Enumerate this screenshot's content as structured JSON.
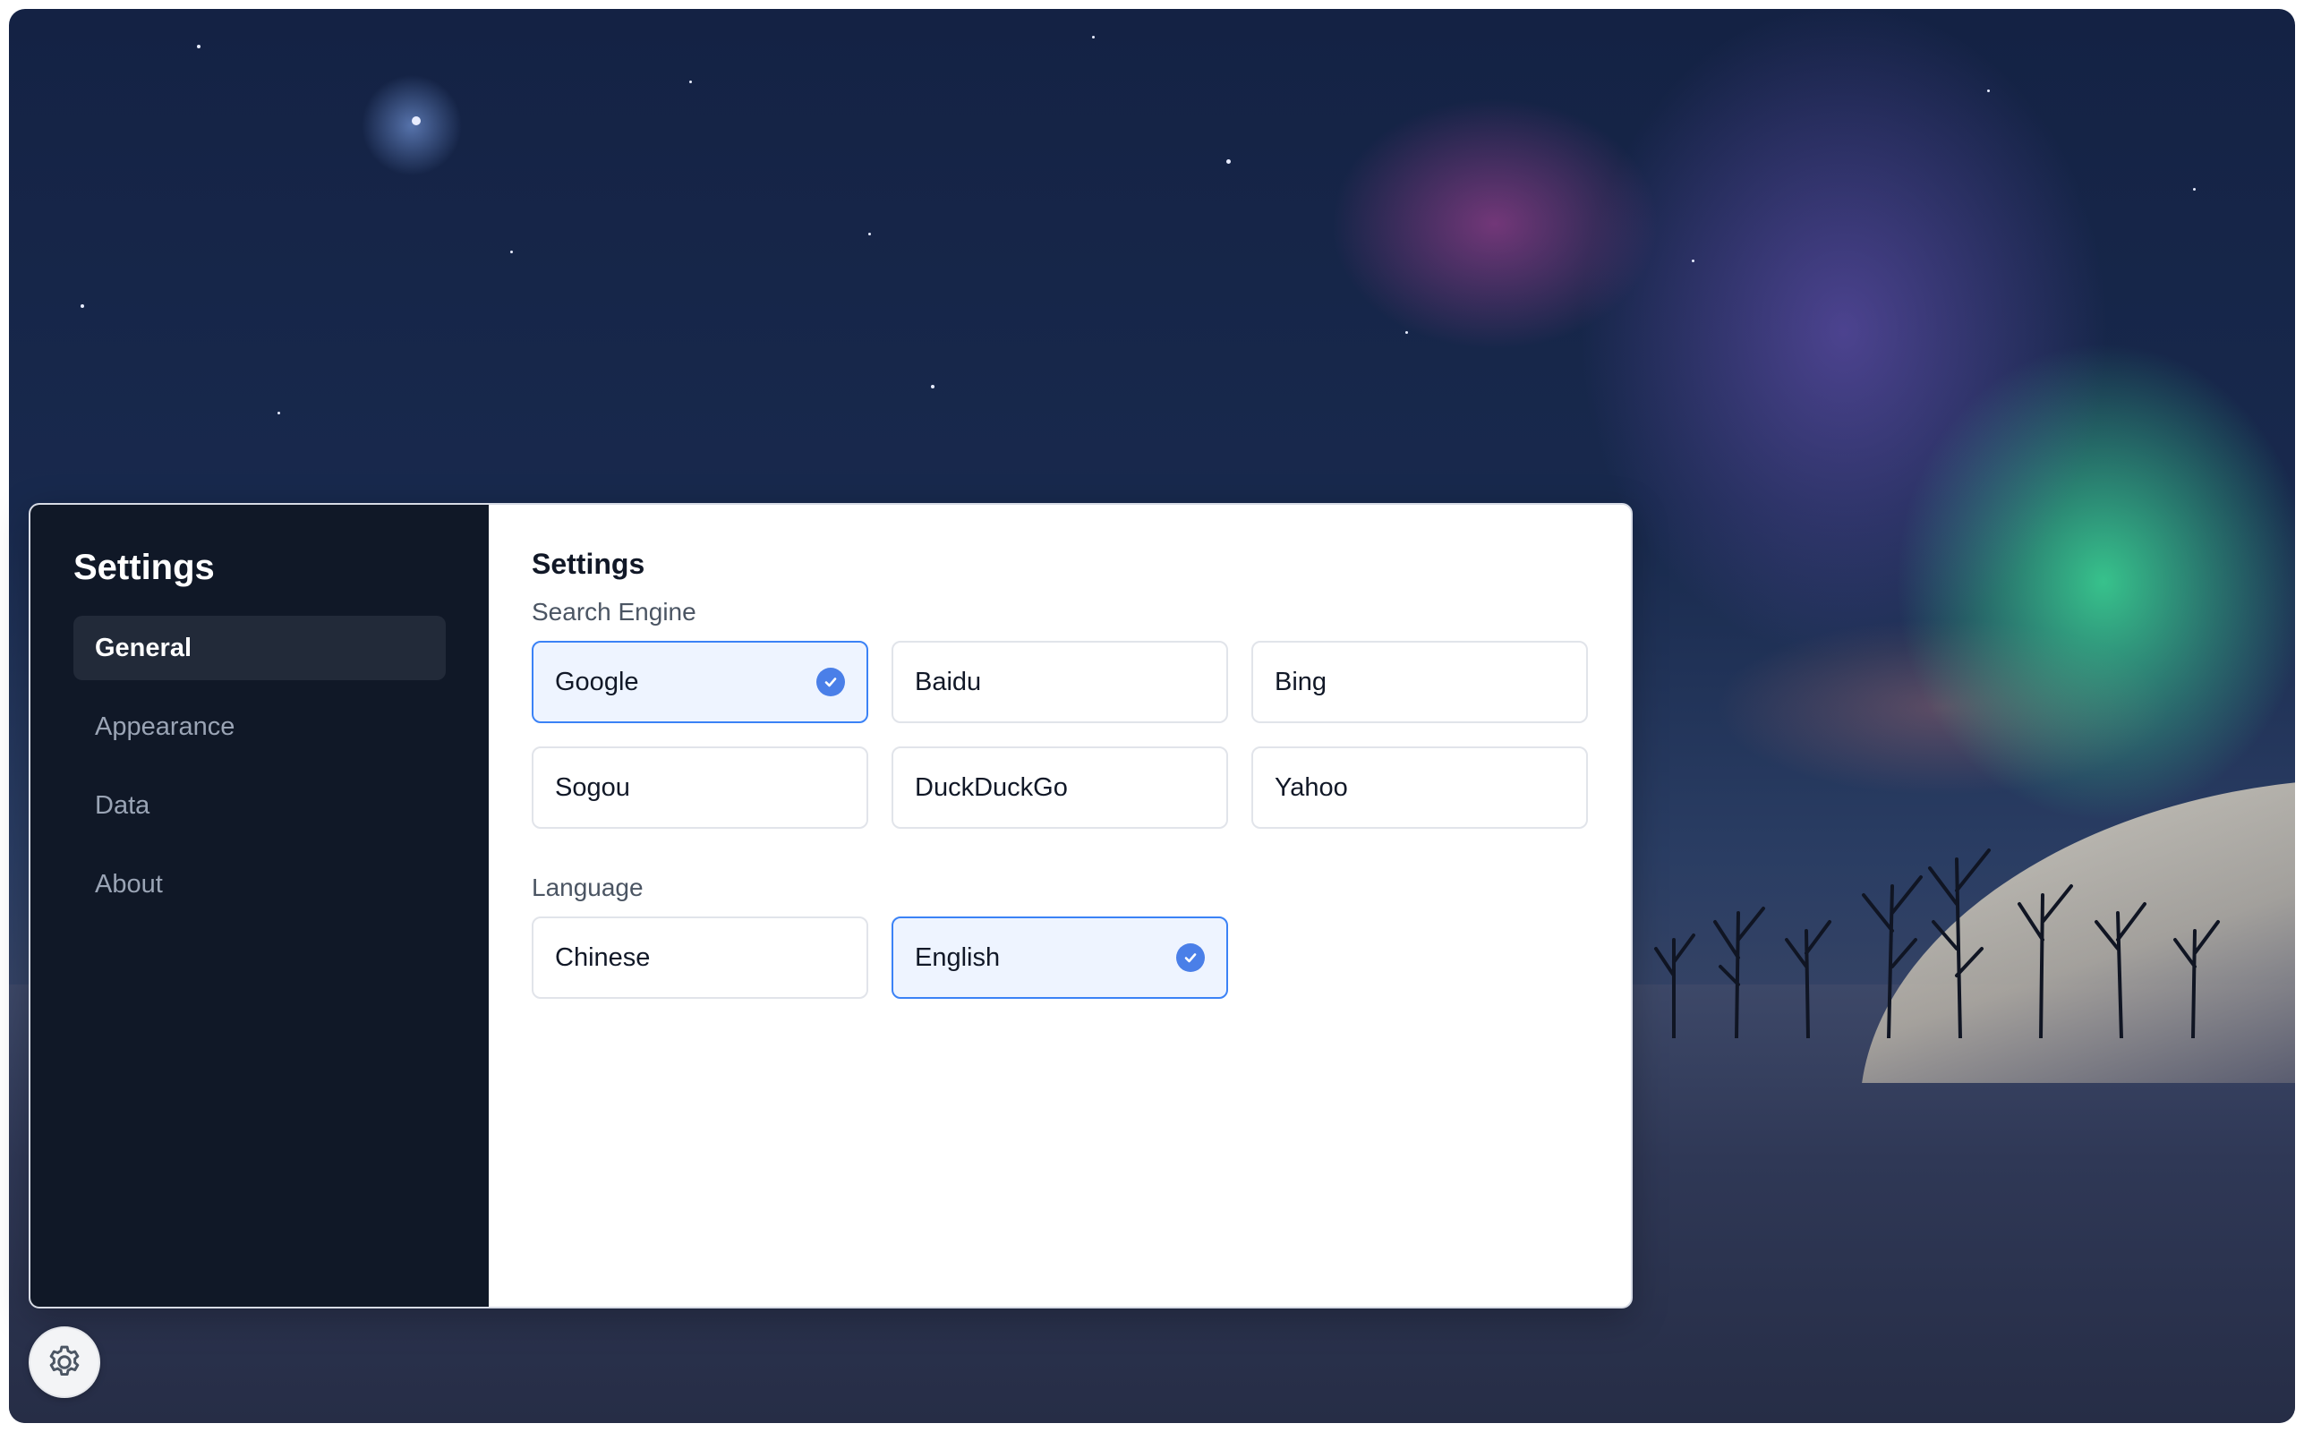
{
  "sidebar": {
    "title": "Settings",
    "items": [
      {
        "label": "General",
        "active": true
      },
      {
        "label": "Appearance",
        "active": false
      },
      {
        "label": "Data",
        "active": false
      },
      {
        "label": "About",
        "active": false
      }
    ]
  },
  "content": {
    "title": "Settings",
    "search_engine": {
      "label": "Search Engine",
      "options": [
        "Google",
        "Baidu",
        "Bing",
        "Sogou",
        "DuckDuckGo",
        "Yahoo"
      ],
      "selected": "Google"
    },
    "language": {
      "label": "Language",
      "options": [
        "Chinese",
        "English"
      ],
      "selected": "English"
    }
  },
  "icons": {
    "check": "check-circle-icon",
    "settings_button": "gear-icon"
  },
  "colors": {
    "accent": "#3b82f6",
    "sidebar_bg": "#101827",
    "selected_bg": "#eef4ff"
  }
}
